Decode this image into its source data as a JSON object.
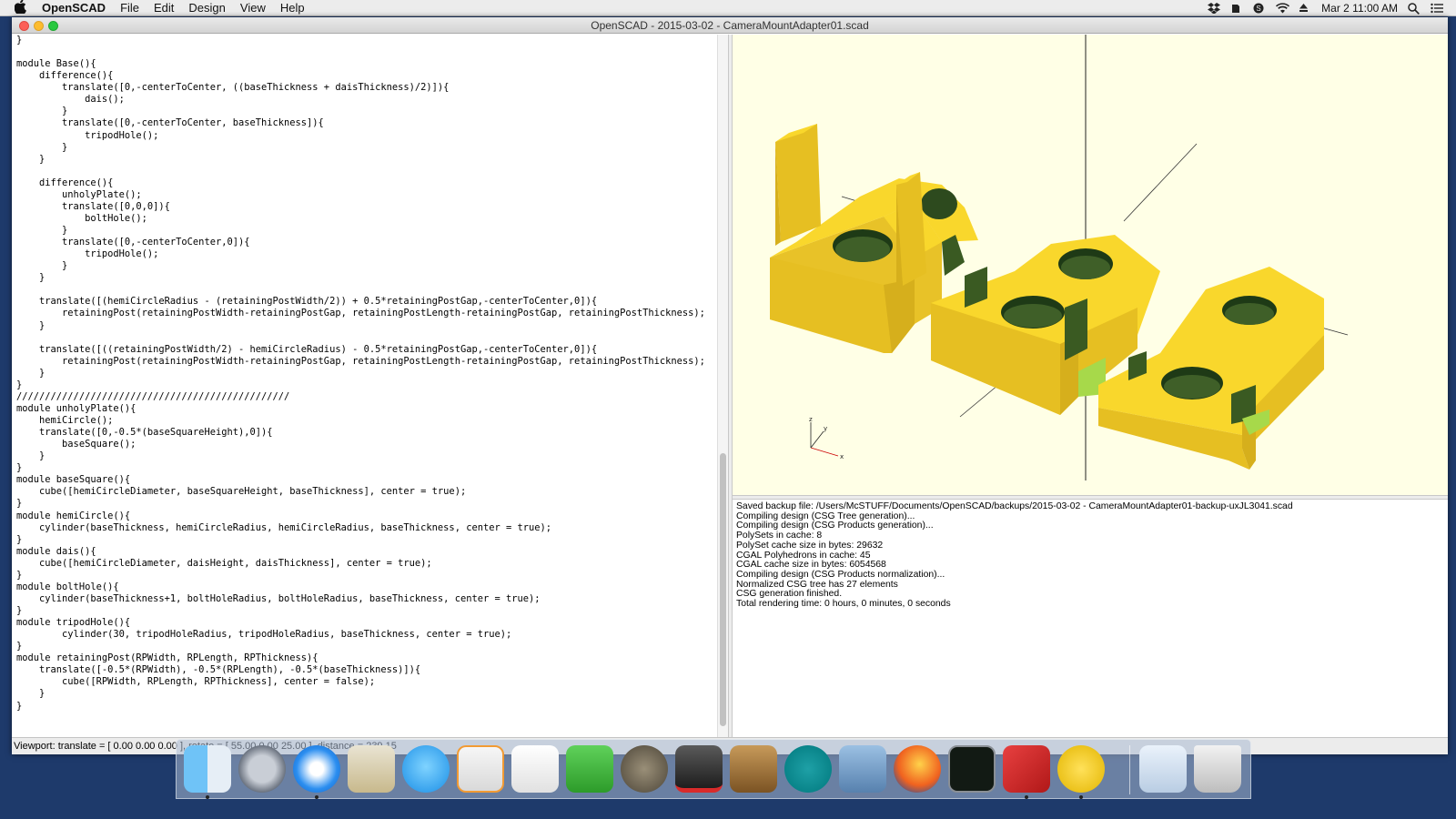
{
  "menubar": {
    "app_name": "OpenSCAD",
    "items": [
      "File",
      "Edit",
      "Design",
      "View",
      "Help"
    ],
    "clock": "Mar 2  11:00 AM"
  },
  "window": {
    "title": "OpenSCAD - 2015-03-02 - CameraMountAdapter01.scad"
  },
  "editor": {
    "lines": [
      "}",
      "",
      "module Base(){",
      "    difference(){",
      "        translate([0,-centerToCenter, ((baseThickness + daisThickness)/2)]){",
      "            dais();",
      "        }",
      "        translate([0,-centerToCenter, baseThickness]){",
      "            tripodHole();",
      "        }",
      "    }",
      "",
      "    difference(){",
      "        unholyPlate();",
      "        translate([0,0,0]){",
      "            boltHole();",
      "        }",
      "        translate([0,-centerToCenter,0]){",
      "            tripodHole();",
      "        }",
      "    }",
      "",
      "    translate([(hemiCircleRadius - (retainingPostWidth/2)) + 0.5*retainingPostGap,-centerToCenter,0]){",
      "        retainingPost(retainingPostWidth-retainingPostGap, retainingPostLength-retainingPostGap, retainingPostThickness);",
      "    }",
      "",
      "    translate([((retainingPostWidth/2) - hemiCircleRadius) - 0.5*retainingPostGap,-centerToCenter,0]){",
      "        retainingPost(retainingPostWidth-retainingPostGap, retainingPostLength-retainingPostGap, retainingPostThickness);",
      "    }",
      "}",
      "////////////////////////////////////////////////",
      "module unholyPlate(){",
      "    hemiCircle();",
      "    translate([0,-0.5*(baseSquareHeight),0]){",
      "        baseSquare();",
      "    }",
      "}",
      "module baseSquare(){",
      "    cube([hemiCircleDiameter, baseSquareHeight, baseThickness], center = true);",
      "}",
      "module hemiCircle(){",
      "    cylinder(baseThickness, hemiCircleRadius, hemiCircleRadius, baseThickness, center = true);",
      "}",
      "module dais(){",
      "    cube([hemiCircleDiameter, daisHeight, daisThickness], center = true);",
      "}",
      "module boltHole(){",
      "    cylinder(baseThickness+1, boltHoleRadius, boltHoleRadius, baseThickness, center = true);",
      "}",
      "module tripodHole(){",
      "        cylinder(30, tripodHoleRadius, tripodHoleRadius, baseThickness, center = true);",
      "}",
      "module retainingPost(RPWidth, RPLength, RPThickness){",
      "    translate([-0.5*(RPWidth), -0.5*(RPLength), -0.5*(baseThickness)]){",
      "        cube([RPWidth, RPLength, RPThickness], center = false);",
      "    }",
      "}"
    ]
  },
  "viewport": {
    "axis_labels": {
      "z": "z",
      "y": "y",
      "x": "x"
    },
    "model_color": "#f9d72c"
  },
  "console": {
    "lines": [
      "Saved backup file: /Users/McSTUFF/Documents/OpenSCAD/backups/2015-03-02 - CameraMountAdapter01-backup-uxJL3041.scad",
      "Compiling design (CSG Tree generation)...",
      "Compiling design (CSG Products generation)...",
      "PolySets in cache: 8",
      "PolySet cache size in bytes: 29632",
      "CGAL Polyhedrons in cache: 45",
      "CGAL cache size in bytes: 6054568",
      "Compiling design (CSG Products normalization)...",
      "Normalized CSG tree has 27 elements",
      "CSG generation finished.",
      "Total rendering time: 0 hours, 0 minutes, 0 seconds"
    ]
  },
  "statusbar": {
    "text": "Viewport: translate = [ 0.00 0.00 0.00 ], rotate = [ 55.00 0.00 25.00 ], distance = 239.15"
  },
  "dock": {
    "apps": [
      "finder-icon",
      "launchpad-icon",
      "safari-icon",
      "preview-icon",
      "messages-icon",
      "pages-icon",
      "textedit-icon",
      "evernote-icon",
      "gimp-icon",
      "autocad-icon",
      "garageband-icon",
      "arduino-icon",
      "iphoto-icon",
      "firefox-icon",
      "activity-monitor-icon",
      "sketchup-icon",
      "openscad-icon",
      "documents-folder-icon",
      "trash-icon"
    ]
  }
}
